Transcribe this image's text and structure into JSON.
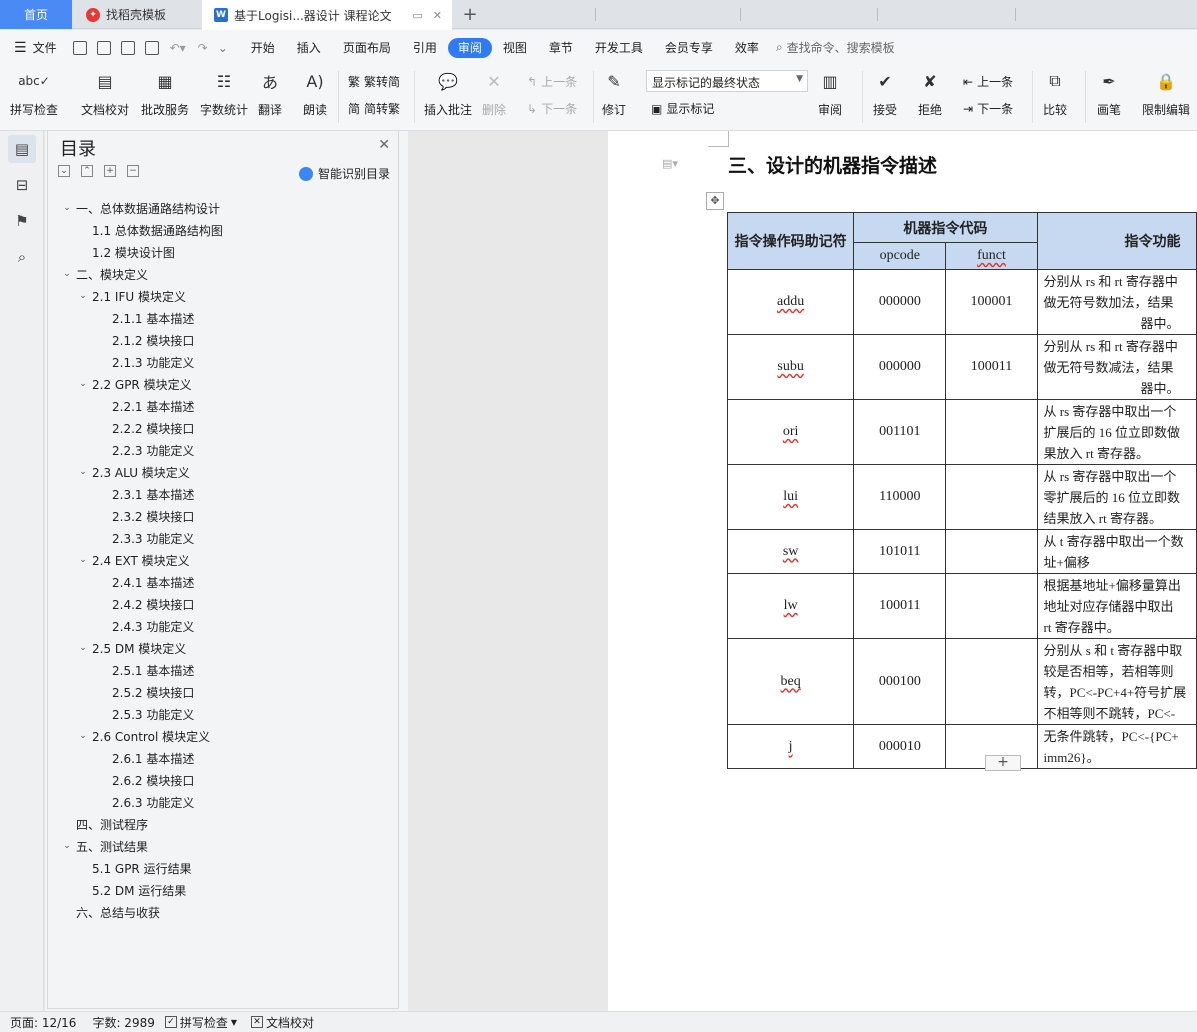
{
  "tabs": {
    "home": "首页",
    "template": "找稻壳模板",
    "document": "基于Logisi...器设计 课程论文"
  },
  "menu": {
    "file": "文件",
    "items": [
      "开始",
      "插入",
      "页面布局",
      "引用",
      "审阅",
      "视图",
      "章节",
      "开发工具",
      "会员专享",
      "效率"
    ],
    "search": "查找命令、搜索模板"
  },
  "ribbon": {
    "spell": "拼写检查",
    "doccheck": "文档校对",
    "revise_service": "批改服务",
    "wordcount": "字数统计",
    "translate": "翻译",
    "read": "朗读",
    "trad": "繁转简",
    "simp": "简转繁",
    "insert_comment": "插入批注",
    "delete": "删除",
    "prev": "上一条",
    "next": "下一条",
    "track": "修订",
    "markup_state": "显示标记的最终状态",
    "show_markup": "显示标记",
    "review": "审阅",
    "accept": "接受",
    "reject": "拒绝",
    "prev2": "上一条",
    "next2": "下一条",
    "compare": "比较",
    "pen": "画笔",
    "restrict": "限制编辑"
  },
  "nav": {
    "title": "目录",
    "smart": "智能识别目录",
    "items": [
      {
        "level": 1,
        "arrow": true,
        "text": "一、总体数据通路结构设计"
      },
      {
        "level": 2,
        "arrow": false,
        "text": "1.1  总体数据通路结构图"
      },
      {
        "level": 2,
        "arrow": false,
        "text": "1.2  模块设计图"
      },
      {
        "level": 1,
        "arrow": true,
        "text": "二、模块定义"
      },
      {
        "level": 2,
        "arrow": true,
        "text": "2.1 IFU 模块定义"
      },
      {
        "level": 3,
        "arrow": false,
        "text": "2.1.1  基本描述"
      },
      {
        "level": 3,
        "arrow": false,
        "text": "2.1.2  模块接口"
      },
      {
        "level": 3,
        "arrow": false,
        "text": "2.1.3  功能定义"
      },
      {
        "level": 2,
        "arrow": true,
        "text": "2.2 GPR 模块定义"
      },
      {
        "level": 3,
        "arrow": false,
        "text": "2.2.1  基本描述"
      },
      {
        "level": 3,
        "arrow": false,
        "text": "2.2.2  模块接口"
      },
      {
        "level": 3,
        "arrow": false,
        "text": "2.2.3  功能定义"
      },
      {
        "level": 2,
        "arrow": true,
        "text": "2.3 ALU 模块定义"
      },
      {
        "level": 3,
        "arrow": false,
        "text": "2.3.1  基本描述"
      },
      {
        "level": 3,
        "arrow": false,
        "text": "2.3.2  模块接口"
      },
      {
        "level": 3,
        "arrow": false,
        "text": "2.3.3  功能定义"
      },
      {
        "level": 2,
        "arrow": true,
        "text": "2.4 EXT 模块定义"
      },
      {
        "level": 3,
        "arrow": false,
        "text": "2.4.1  基本描述"
      },
      {
        "level": 3,
        "arrow": false,
        "text": "2.4.2  模块接口"
      },
      {
        "level": 3,
        "arrow": false,
        "text": "2.4.3  功能定义"
      },
      {
        "level": 2,
        "arrow": true,
        "text": "2.5 DM 模块定义"
      },
      {
        "level": 3,
        "arrow": false,
        "text": "2.5.1  基本描述"
      },
      {
        "level": 3,
        "arrow": false,
        "text": "2.5.2  模块接口"
      },
      {
        "level": 3,
        "arrow": false,
        "text": "2.5.3  功能定义"
      },
      {
        "level": 2,
        "arrow": true,
        "text": "2.6 Control 模块定义"
      },
      {
        "level": 3,
        "arrow": false,
        "text": "2.6.1  基本描述"
      },
      {
        "level": 3,
        "arrow": false,
        "text": "2.6.2  模块接口"
      },
      {
        "level": 3,
        "arrow": false,
        "text": "2.6.3  功能定义"
      },
      {
        "level": 1,
        "arrow": false,
        "text": "三、设计的机器指令描述",
        "selected": true
      },
      {
        "level": 1,
        "arrow": false,
        "text": "四、测试程序"
      },
      {
        "level": 1,
        "arrow": true,
        "text": "五、测试结果"
      },
      {
        "level": 2,
        "arrow": false,
        "text": "5.1 GPR 运行结果"
      },
      {
        "level": 2,
        "arrow": false,
        "text": "5.2 DM 运行结果"
      },
      {
        "level": 1,
        "arrow": false,
        "text": "六、总结与收获"
      }
    ]
  },
  "doc": {
    "heading": "三、设计的机器指令描述",
    "table": {
      "h_mnemonic": "指令操作码助记符",
      "h_code": "机器指令代码",
      "h_opcode": "opcode",
      "h_funct": "funct",
      "h_func": "指令功能",
      "rows": [
        {
          "m": "addu",
          "op": "000000",
          "fn": "100001",
          "desc": [
            "分别从 rs 和 rt 寄存器中",
            "做无符号数加法，结果",
            "器中。"
          ]
        },
        {
          "m": "subu",
          "op": "000000",
          "fn": "100011",
          "desc": [
            "分别从 rs 和 rt 寄存器中",
            "做无符号数减法，结果",
            "器中。"
          ]
        },
        {
          "m": "ori",
          "op": "001101",
          "fn": "",
          "desc": [
            "从 rs 寄存器中取出一个",
            "扩展后的 16 位立即数做",
            "果放入 rt 寄存器。"
          ]
        },
        {
          "m": "lui",
          "op": "110000",
          "fn": "",
          "desc": [
            "从 rs 寄存器中取出一个",
            "零扩展后的 16 位立即数",
            "结果放入 rt 寄存器。"
          ]
        },
        {
          "m": "sw",
          "op": "101011",
          "fn": "",
          "desc": [
            "从 t 寄存器中取出一个数",
            "址+偏移"
          ]
        },
        {
          "m": "lw",
          "op": "100011",
          "fn": "",
          "desc": [
            "根据基地址+偏移量算出",
            "地址对应存储器中取出",
            "rt 寄存器中。"
          ]
        },
        {
          "m": "beq",
          "op": "000100",
          "fn": "",
          "desc": [
            "分别从 s 和 t 寄存器中取",
            "较是否相等，若相等则",
            "转，PC<-PC+4+符号扩展",
            "不相等则不跳转，PC<-"
          ]
        },
        {
          "m": "j",
          "op": "000010",
          "fn": "",
          "desc": [
            "无条件跳转，PC<-{PC+",
            "imm26}。"
          ]
        }
      ]
    }
  },
  "status": {
    "page": "页面: 12/16",
    "words": "字数: 2989",
    "spell": "拼写检查",
    "doccheck": "文档校对"
  }
}
